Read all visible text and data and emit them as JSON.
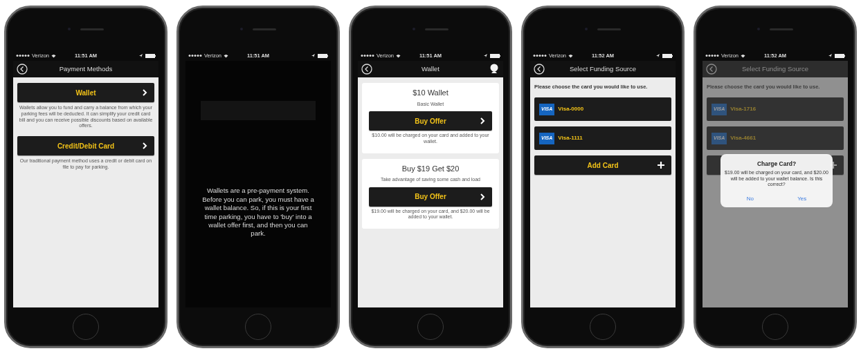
{
  "phones": [
    {
      "kind": "menu",
      "status": {
        "carrier": "Verizon",
        "time": "11:51 AM"
      },
      "nav": {
        "title": "Payment Methods",
        "back": true
      },
      "options": [
        {
          "label": "Wallet",
          "description": "Wallets allow you to fund and carry a balance from which your parking fees will be deducted. It can simplify your credit card bill and you can receive possible discounts based on available offers."
        },
        {
          "label": "Credit/Debit Card",
          "description": "Our traditional payment method uses a credit or debit card on file to pay for parking."
        }
      ]
    },
    {
      "kind": "overlay",
      "status": {
        "carrier": "Verizon",
        "time": "11:51 AM"
      },
      "message": "Wallets are a pre-payment system. Before you can park, you must have a wallet balance. So, if this is your first time parking, you have to 'buy' into a wallet offer first, and then you can park."
    },
    {
      "kind": "offers",
      "status": {
        "carrier": "Verizon",
        "time": "11:51 AM"
      },
      "nav": {
        "title": "Wallet",
        "back": true,
        "profile": true
      },
      "offers": [
        {
          "title": "$10 Wallet",
          "subtitle": "Basic Wallet",
          "button": "Buy Offer",
          "note": "$10.00 will be charged on your card and added to your wallet."
        },
        {
          "title": "Buy $19 Get $20",
          "subtitle": "Take advantage of saving some cash and load",
          "button": "Buy Offer",
          "note": "$19.00 will be charged on your card, and $20.00 will be added to your wallet."
        }
      ]
    },
    {
      "kind": "cards",
      "status": {
        "carrier": "Verizon",
        "time": "11:52 AM"
      },
      "nav": {
        "title": "Select Funding Source",
        "back": true
      },
      "prompt": "Please choose the card you would like to use.",
      "cards": [
        {
          "brand": "VISA",
          "label": "Visa-0000"
        },
        {
          "brand": "VISA",
          "label": "Visa-1111"
        }
      ],
      "add_button": {
        "shown": true,
        "label": "Add Card"
      }
    },
    {
      "kind": "cards",
      "status": {
        "carrier": "Verizon",
        "time": "11:52 AM"
      },
      "nav": {
        "title": "Select Funding Source",
        "back": true
      },
      "prompt": "Please choose the card you would like to use.",
      "cards": [
        {
          "brand": "VISA",
          "label": "Visa-1716"
        },
        {
          "brand": "VISA",
          "label": "Visa-4661"
        }
      ],
      "add_button": {
        "shown": true
      },
      "dialog": {
        "title": "Charge Card?",
        "message": "$19.00 will be charged on your card, and $20.00 will be added to your wallet balance. Is this correct?",
        "buttons": [
          "No",
          "Yes"
        ]
      }
    }
  ]
}
